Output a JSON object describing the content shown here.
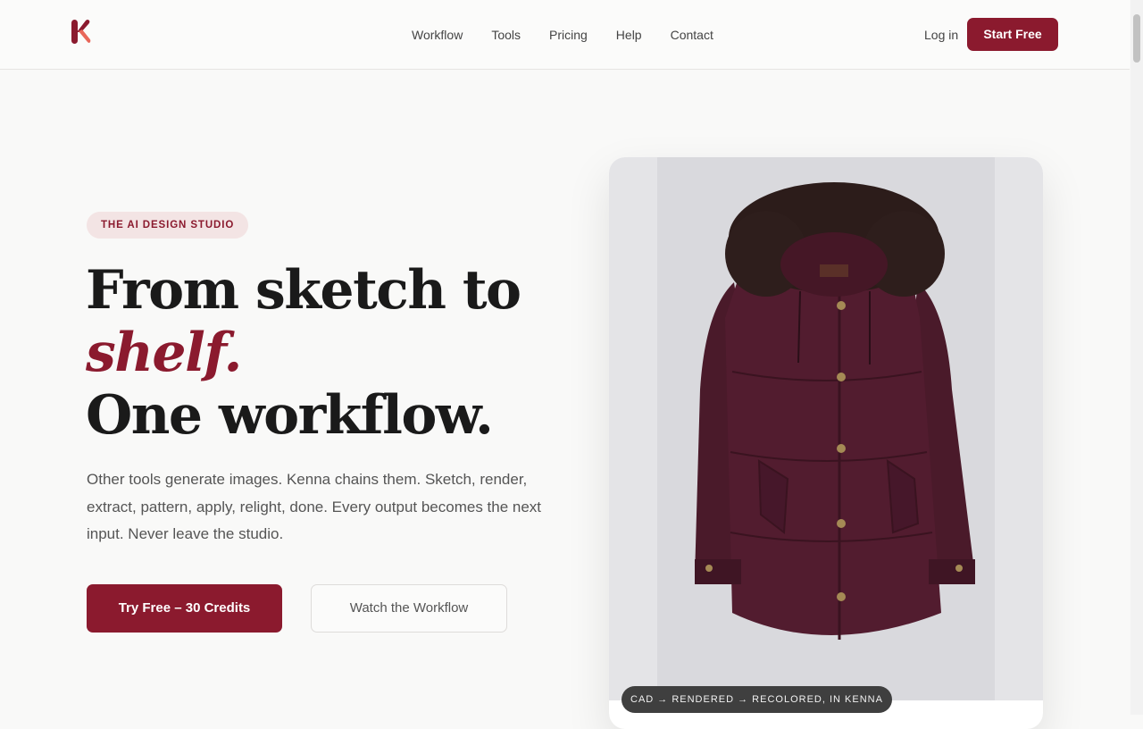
{
  "brand": {
    "name": "Kenna",
    "color": "#8b1a2e",
    "logo_icon": "k-logo-icon"
  },
  "nav": {
    "items": [
      {
        "label": "Workflow"
      },
      {
        "label": "Tools"
      },
      {
        "label": "Pricing"
      },
      {
        "label": "Help"
      },
      {
        "label": "Contact"
      }
    ],
    "login_label": "Log in",
    "start_label": "Start Free"
  },
  "hero": {
    "badge": "THE AI DESIGN STUDIO",
    "headline_line1": "From sketch to",
    "headline_accent": "shelf.",
    "headline_line3": "One workflow.",
    "lead": "Other tools generate images. Kenna chains them. Sketch, render, extract, pattern, apply, relight, done. Every output becomes the next input. Never leave the studio.",
    "primary_cta": "Try Free – 30 Credits",
    "secondary_cta": "Watch the Workflow"
  },
  "showcase": {
    "image_subject": "burgundy parka with fur hood",
    "caption": "CAD → RENDERED → RECOLORED, IN KENNA"
  }
}
